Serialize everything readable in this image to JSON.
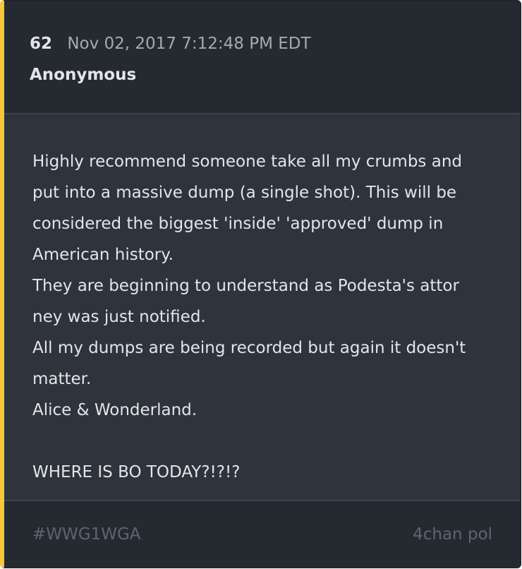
{
  "post": {
    "number": "62",
    "date": "Nov 02, 2017 7:12:48 PM EDT",
    "author": "Anonymous",
    "body_lines": [
      "Highly recommend someone take all my crumbs and",
      "put into a massive dump (a single shot). This will be",
      "considered the biggest 'inside' 'approved' dump in",
      "American history.",
      "They are beginning to understand as Podesta's attor",
      "ney was just notified.",
      "All my dumps are being recorded but again it doesn't",
      "matter.",
      "Alice & Wonderland.",
      "",
      "WHERE IS BO TODAY?!?!?"
    ]
  },
  "footer": {
    "hashtag": "#WWG1WGA",
    "source": "4chan pol"
  },
  "colors": {
    "accent_bar": "#f6c63b",
    "card_background": "#2e333c",
    "header_background": "#252a31",
    "primary_text": "#e3e5e8",
    "muted_text": "#5f6570"
  }
}
